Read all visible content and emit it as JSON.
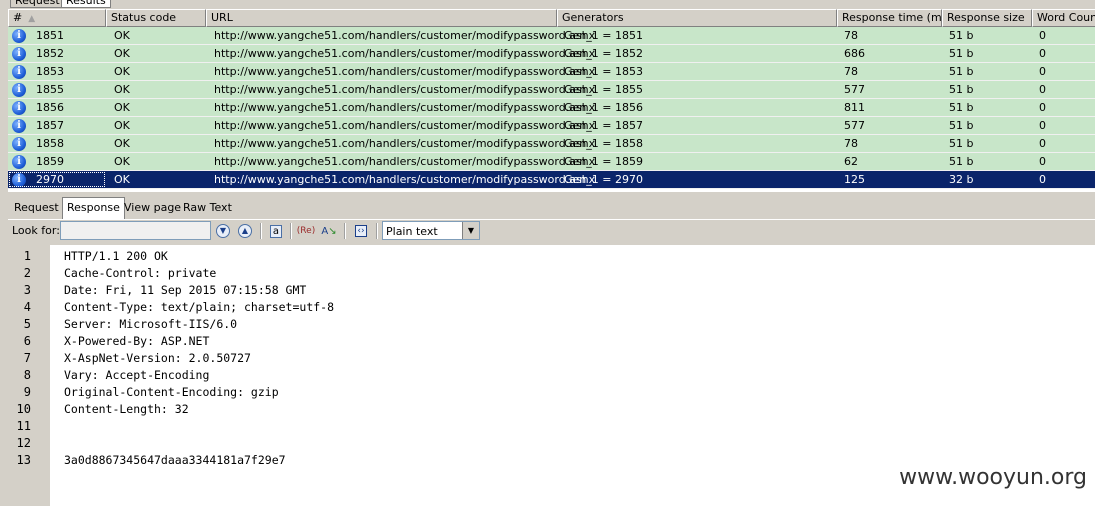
{
  "top_tabs": [
    "Request",
    "Results"
  ],
  "columns": [
    "#",
    "Status code",
    "URL",
    "Generators",
    "Response time (ms)",
    "Response size",
    "Word Count"
  ],
  "rows": [
    {
      "id": "1851",
      "status": "OK",
      "url": "http://www.yangche51.com/handlers/customer/modifypassword.ashx",
      "gen": "Gen_1 = 1851",
      "time": "78",
      "size": "51 b",
      "words": "0"
    },
    {
      "id": "1852",
      "status": "OK",
      "url": "http://www.yangche51.com/handlers/customer/modifypassword.ashx",
      "gen": "Gen_1 = 1852",
      "time": "686",
      "size": "51 b",
      "words": "0"
    },
    {
      "id": "1853",
      "status": "OK",
      "url": "http://www.yangche51.com/handlers/customer/modifypassword.ashx",
      "gen": "Gen_1 = 1853",
      "time": "78",
      "size": "51 b",
      "words": "0"
    },
    {
      "id": "1855",
      "status": "OK",
      "url": "http://www.yangche51.com/handlers/customer/modifypassword.ashx",
      "gen": "Gen_1 = 1855",
      "time": "577",
      "size": "51 b",
      "words": "0"
    },
    {
      "id": "1856",
      "status": "OK",
      "url": "http://www.yangche51.com/handlers/customer/modifypassword.ashx",
      "gen": "Gen_1 = 1856",
      "time": "811",
      "size": "51 b",
      "words": "0"
    },
    {
      "id": "1857",
      "status": "OK",
      "url": "http://www.yangche51.com/handlers/customer/modifypassword.ashx",
      "gen": "Gen_1 = 1857",
      "time": "577",
      "size": "51 b",
      "words": "0"
    },
    {
      "id": "1858",
      "status": "OK",
      "url": "http://www.yangche51.com/handlers/customer/modifypassword.ashx",
      "gen": "Gen_1 = 1858",
      "time": "78",
      "size": "51 b",
      "words": "0"
    },
    {
      "id": "1859",
      "status": "OK",
      "url": "http://www.yangche51.com/handlers/customer/modifypassword.ashx",
      "gen": "Gen_1 = 1859",
      "time": "62",
      "size": "51 b",
      "words": "0"
    },
    {
      "id": "2970",
      "status": "OK",
      "url": "http://www.yangche51.com/handlers/customer/modifypassword.ashx",
      "gen": "Gen_1 = 2970",
      "time": "125",
      "size": "32 b",
      "words": "0",
      "selected": true
    }
  ],
  "bottom_tabs": [
    "Request",
    "Response",
    "View page",
    "Raw Text"
  ],
  "active_bottom_tab": "Response",
  "lookfor": {
    "label": "Look for:",
    "value": ""
  },
  "format_select": "Plain text",
  "lines": [
    {
      "n": "1",
      "text": "HTTP/1.1 200 OK"
    },
    {
      "n": "2",
      "text": "Cache-Control: private"
    },
    {
      "n": "3",
      "text": "Date: Fri, 11 Sep 2015 07:15:58 GMT"
    },
    {
      "n": "4",
      "text": "Content-Type: text/plain; charset=utf-8"
    },
    {
      "n": "5",
      "text": "Server: Microsoft-IIS/6.0"
    },
    {
      "n": "6",
      "text": "X-Powered-By: ASP.NET"
    },
    {
      "n": "7",
      "text": "X-AspNet-Version: 2.0.50727"
    },
    {
      "n": "8",
      "text": "Vary: Accept-Encoding"
    },
    {
      "n": "9",
      "text": "Original-Content-Encoding: gzip"
    },
    {
      "n": "10",
      "text": "Content-Length: 32"
    },
    {
      "n": "11",
      "text": ""
    },
    {
      "n": "12",
      "text": ""
    },
    {
      "n": "13",
      "text": "3a0d8867345647daaa3344181a7f29e7"
    }
  ],
  "watermark": "www.wooyun.org",
  "colors": {
    "row_ok": "#c8e6c9",
    "row_selected": "#0a246a",
    "chrome": "#d4d0c8"
  },
  "icons": {
    "row": "info-icon",
    "search_down": "find-next-icon",
    "search_up": "find-prev-icon",
    "highlight": "highlight-icon",
    "regex": "regex-icon",
    "replace": "replace-icon",
    "wrap": "wrap-icon"
  }
}
